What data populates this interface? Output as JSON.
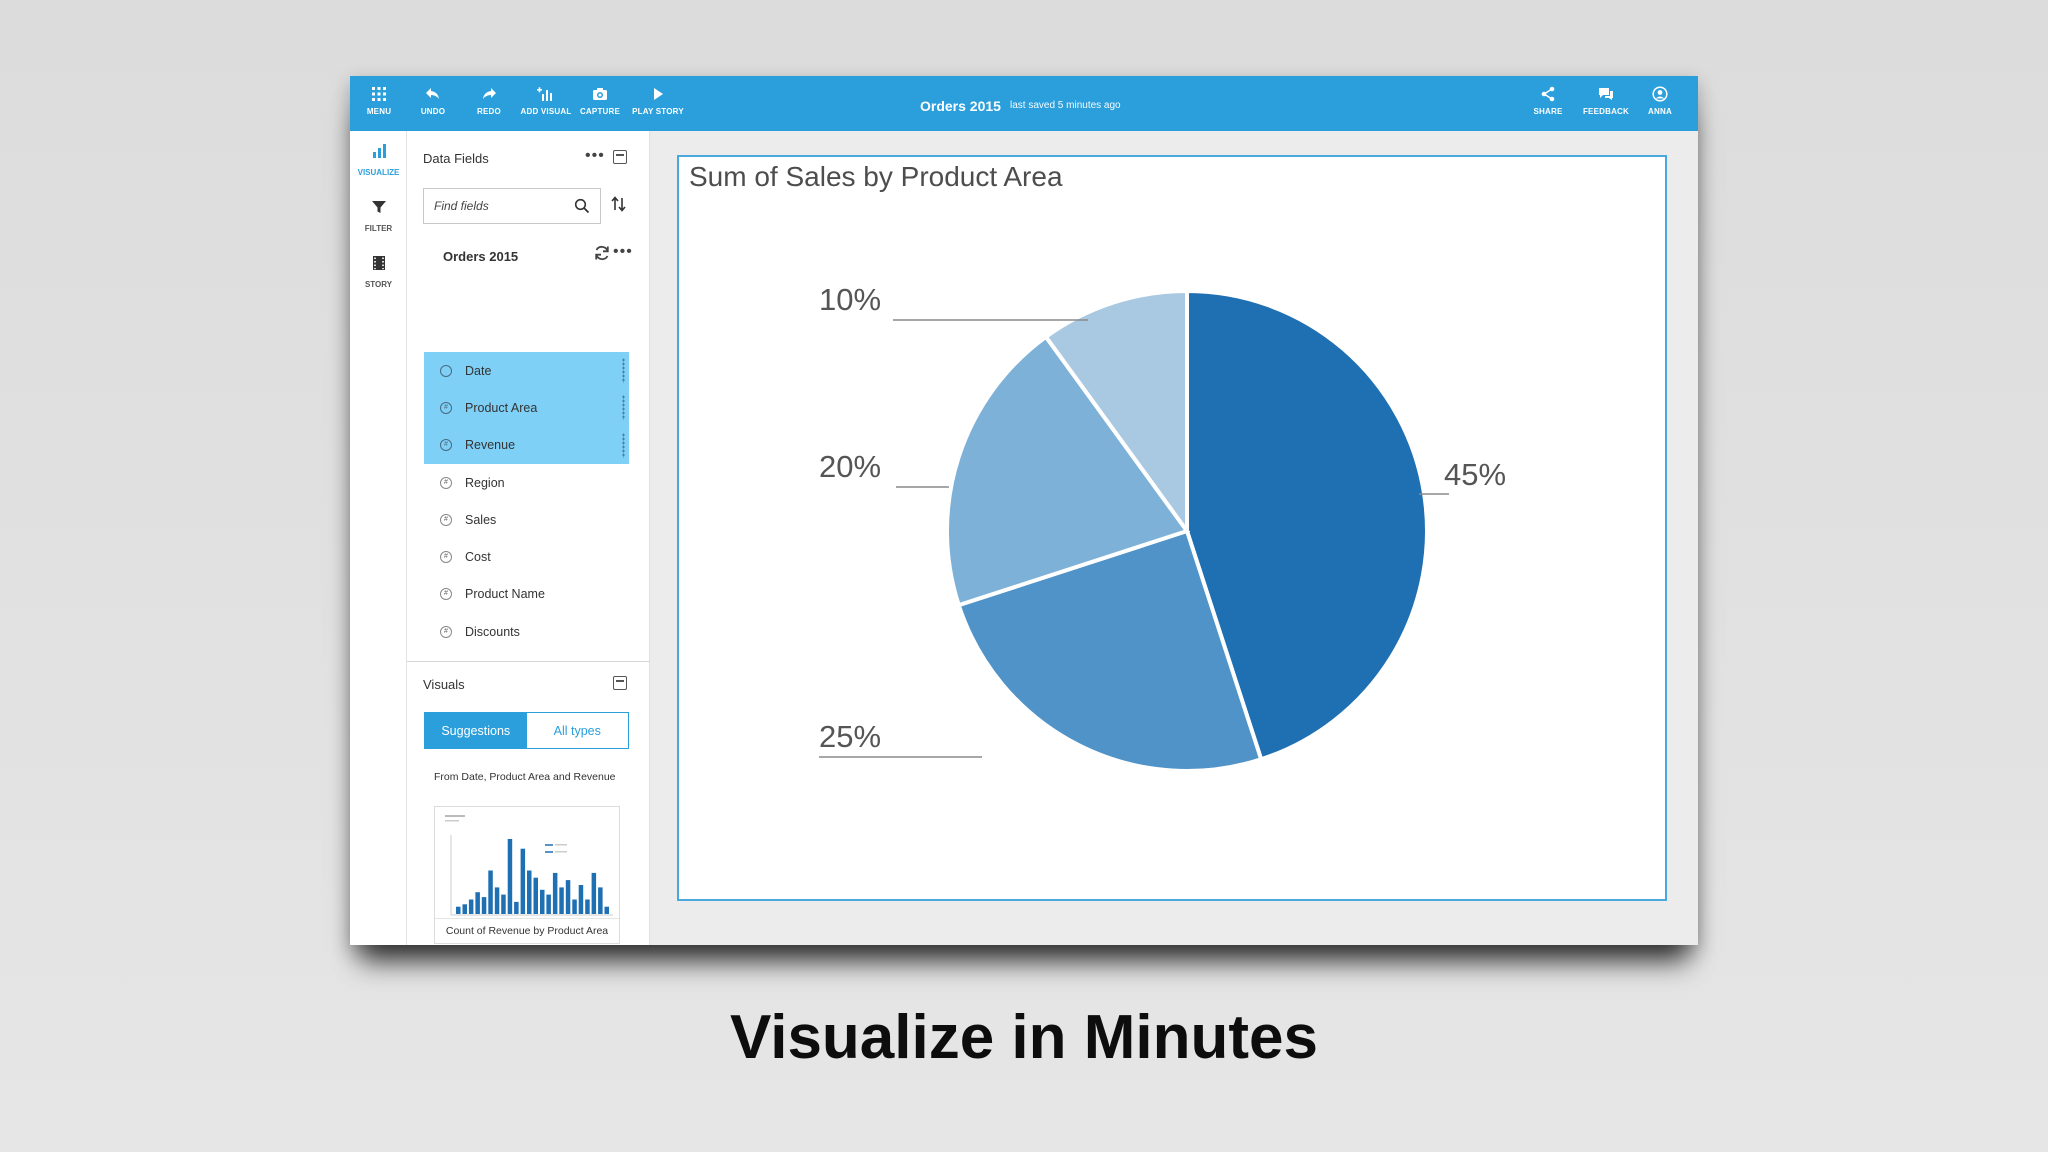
{
  "toolbar": {
    "menu": "MENU",
    "undo": "UNDO",
    "redo": "REDO",
    "add_visual": "ADD VISUAL",
    "capture": "CAPTURE",
    "play_story": "PLAY STORY",
    "doc_title": "Orders 2015",
    "saved_status": "last saved 5 minutes ago",
    "share": "SHARE",
    "feedback": "FEEDBACK",
    "user": "ANNA"
  },
  "rail": {
    "visualize": "VISUALIZE",
    "filter": "FILTER",
    "story": "STORY"
  },
  "data_panel": {
    "title": "Data Fields",
    "search_placeholder": "Find fields",
    "dataset": "Orders 2015",
    "fields": [
      {
        "label": "Date",
        "selected": true
      },
      {
        "label": "Product Area",
        "selected": true
      },
      {
        "label": "Revenue",
        "selected": true
      },
      {
        "label": "Region",
        "selected": false
      },
      {
        "label": "Sales",
        "selected": false
      },
      {
        "label": "Cost",
        "selected": false
      },
      {
        "label": "Product Name",
        "selected": false
      },
      {
        "label": "Discounts",
        "selected": false
      }
    ],
    "visuals_title": "Visuals",
    "tab_suggestions": "Suggestions",
    "tab_all_types": "All types",
    "from_text": "From Date, Product Area and Revenue",
    "thumb1_caption": "Count of Revenue by Product Area",
    "thumb1_values": [
      3,
      4,
      6,
      9,
      7,
      18,
      11,
      8,
      31,
      5,
      27,
      18,
      15,
      10,
      8,
      17,
      11,
      14,
      6,
      12,
      6,
      17,
      11,
      3
    ]
  },
  "colors": {
    "accent": "#2b9fdc",
    "selected_field": "#7fd0f7"
  },
  "chart_data": {
    "type": "pie",
    "title": "Sum of Sales by Product Area",
    "slices": [
      {
        "label": "45%",
        "value": 45,
        "color": "#1f6fb3"
      },
      {
        "label": "25%",
        "value": 25,
        "color": "#4f93c8"
      },
      {
        "label": "20%",
        "value": 20,
        "color": "#7db1d8"
      },
      {
        "label": "10%",
        "value": 10,
        "color": "#a9c9e2"
      }
    ]
  },
  "caption": "Visualize in Minutes"
}
